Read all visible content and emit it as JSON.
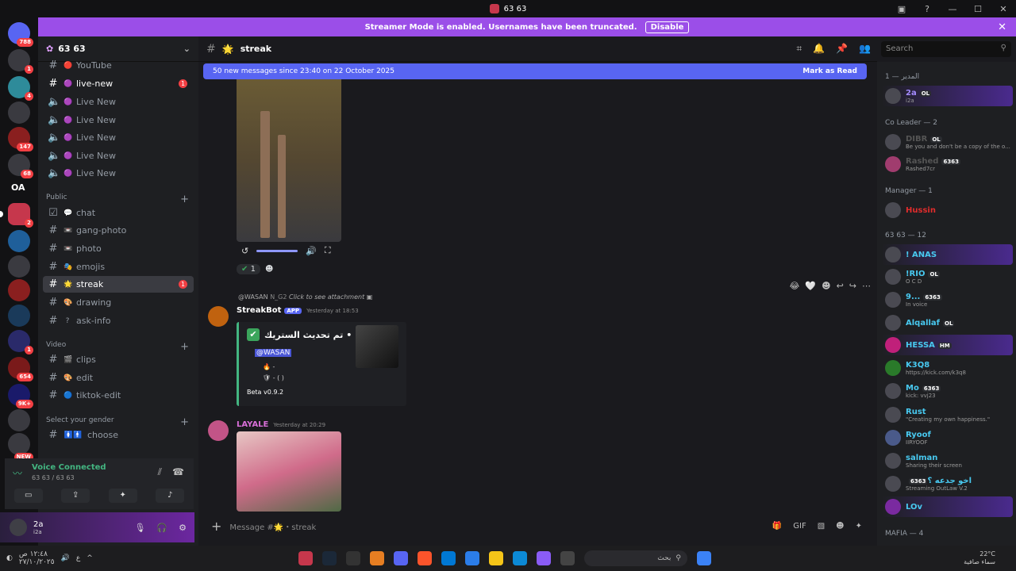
{
  "window": {
    "title": "63 63"
  },
  "banner": {
    "text": "Streamer Mode is enabled. Usernames have been truncated.",
    "button": "Disable"
  },
  "guild_badges": [
    "788",
    "1",
    "4",
    "147",
    "68",
    "2",
    "1",
    "654",
    "9K+",
    "NEW"
  ],
  "guild_text": [
    "OA"
  ],
  "server": {
    "name": "63 63"
  },
  "channels": [
    {
      "name": "YouTube",
      "emoji": "🔴"
    },
    {
      "name": "live-new",
      "emoji": "🟣",
      "badge": "1"
    },
    {
      "name": "Live New",
      "emoji": "🟣"
    },
    {
      "name": "Live New",
      "emoji": "🟣"
    },
    {
      "name": "Live New",
      "emoji": "🟣"
    },
    {
      "name": "Live New",
      "emoji": "🟣"
    },
    {
      "name": "Live New",
      "emoji": "🟣"
    }
  ],
  "categories": {
    "public": "Public",
    "video": "Video",
    "gender": "Select your gender"
  },
  "public_channels": [
    {
      "name": "chat",
      "emoji": "💬"
    },
    {
      "name": "gang-photo",
      "emoji": "📼"
    },
    {
      "name": "photo",
      "emoji": "📼"
    },
    {
      "name": "emojis",
      "emoji": "🎭"
    },
    {
      "name": "streak",
      "emoji": "🌟",
      "badge": "1"
    },
    {
      "name": "drawing",
      "emoji": "🎨"
    },
    {
      "name": "ask-info",
      "emoji": "?"
    }
  ],
  "video_channels": [
    {
      "name": "clips",
      "emoji": "🎬"
    },
    {
      "name": "edit",
      "emoji": "🎨"
    },
    {
      "name": "tiktok-edit",
      "emoji": "🔵"
    }
  ],
  "gender_channels": [
    {
      "name": "choose",
      "emoji": "🚺🚹"
    }
  ],
  "voice": {
    "status": "Voice Connected",
    "server": "63 63 / 63 63"
  },
  "user": {
    "name": "2a",
    "status": "i2a"
  },
  "header": {
    "channel": "streak",
    "emoji": "🌟"
  },
  "search": {
    "placeholder": "Search"
  },
  "new_messages": {
    "text": "50 new messages since 23:40 on 22 October 2025",
    "action": "Mark as Read"
  },
  "reaction": {
    "count": "1"
  },
  "reply": {
    "user": "@WASAN",
    "tag": "N_G2",
    "text": "Click to see attachment"
  },
  "msg1": {
    "author": "StreakBot",
    "badge": "APP",
    "time": "Yesterday at 18:53"
  },
  "embed": {
    "title": "تم تحديث الستريك •",
    "mention": "@WASAN",
    "line1": "🔥 -",
    "line2": "🛡 - (  )",
    "footer": "Beta v0.9.2"
  },
  "msg2": {
    "author": "LAYALE",
    "time": "Yesterday at 20:29"
  },
  "composer": {
    "placeholder": "Message #🌟・streak"
  },
  "member_groups": {
    "g1": "المدير — 1",
    "g2": "Co Leader — 2",
    "g3": "Manager — 1",
    "g4": "63 63 — 12",
    "g5": "MAFIA — 4"
  },
  "members": [
    {
      "name": "2a",
      "tag": "OL",
      "status": "i2a",
      "color": "#a48bff",
      "nitro": true
    },
    {
      "name": "DIBR",
      "tag": "OL",
      "status": "Be you and don't be a copy of the o...",
      "color": "#444"
    },
    {
      "name": "Rashed",
      "tag": "6363",
      "status": "Rashed7cr",
      "color": "#444"
    },
    {
      "name": "Hussin",
      "tag": "",
      "status": "",
      "color": "#e12c2c"
    },
    {
      "name": "! ANAS",
      "tag": "",
      "status": "",
      "color": "#48c9f0",
      "nitro": true
    },
    {
      "name": "!RIO",
      "tag": "OL",
      "status": "O C D",
      "color": "#48c9f0"
    },
    {
      "name": "9...",
      "tag": "6363",
      "status": "In voice",
      "color": "#48c9f0"
    },
    {
      "name": "Alqallaf",
      "tag": "OL",
      "status": "",
      "color": "#48c9f0"
    },
    {
      "name": "HESSA",
      "tag": "HM",
      "status": "",
      "color": "#48c9f0",
      "nitro": true
    },
    {
      "name": "K3Q8",
      "tag": "",
      "status": "https://kick.com/k3q8",
      "color": "#48c9f0"
    },
    {
      "name": "Mo",
      "tag": "6363",
      "status": "kick: vvj23",
      "color": "#48c9f0"
    },
    {
      "name": "Rust",
      "tag": "",
      "status": "\"Creating my own happiness.\"",
      "color": "#48c9f0"
    },
    {
      "name": "Ryoof",
      "tag": "",
      "status": "IIRYOOF",
      "color": "#48c9f0"
    },
    {
      "name": "salman",
      "tag": "",
      "status": "Sharing their screen",
      "color": "#48c9f0"
    },
    {
      "name": "اخو جدعه ؟",
      "tag": "6363",
      "status": "Streaming OutLaw V.2",
      "color": "#48c9f0"
    },
    {
      "name": "LOv",
      "tag": "",
      "status": "",
      "color": "#48c9f0",
      "nitro": true
    }
  ],
  "taskbar": {
    "clock": "١٢:٤٨ ص",
    "date": "٢٧/١٠/٢٠٢٥",
    "weather": "22°C",
    "weather_desc": "سماء صافية",
    "search": "بحث"
  }
}
